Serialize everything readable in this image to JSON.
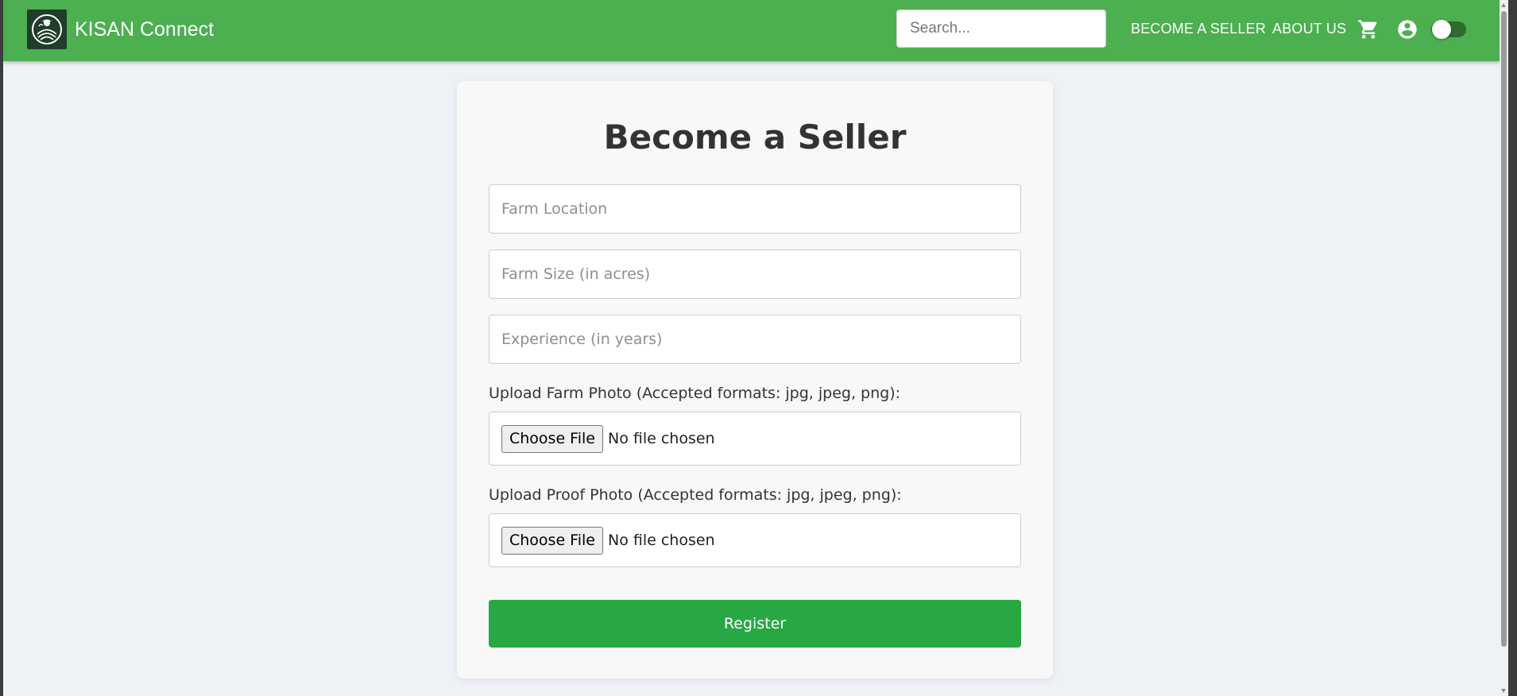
{
  "navbar": {
    "brand": "KISAN Connect",
    "search_placeholder": "Search...",
    "links": {
      "become_seller": "BECOME A SELLER",
      "about_us": "ABOUT US"
    },
    "icons": [
      "cart-icon",
      "account-icon",
      "theme-toggle"
    ],
    "toggle_on": false
  },
  "form": {
    "title": "Become a Seller",
    "farm_location_placeholder": "Farm Location",
    "farm_size_placeholder": "Farm Size (in acres)",
    "experience_placeholder": "Experience (in years)",
    "farm_photo_label": "Upload Farm Photo (Accepted formats: jpg, jpeg, png):",
    "proof_photo_label": "Upload Proof Photo (Accepted formats: jpg, jpeg, png):",
    "choose_file": "Choose File",
    "no_file": "No file chosen",
    "register": "Register"
  },
  "colors": {
    "navbar": "#4caf50",
    "register_button": "#28a745",
    "page_background": "#eef1f5",
    "card_background": "#f8f8f8"
  }
}
